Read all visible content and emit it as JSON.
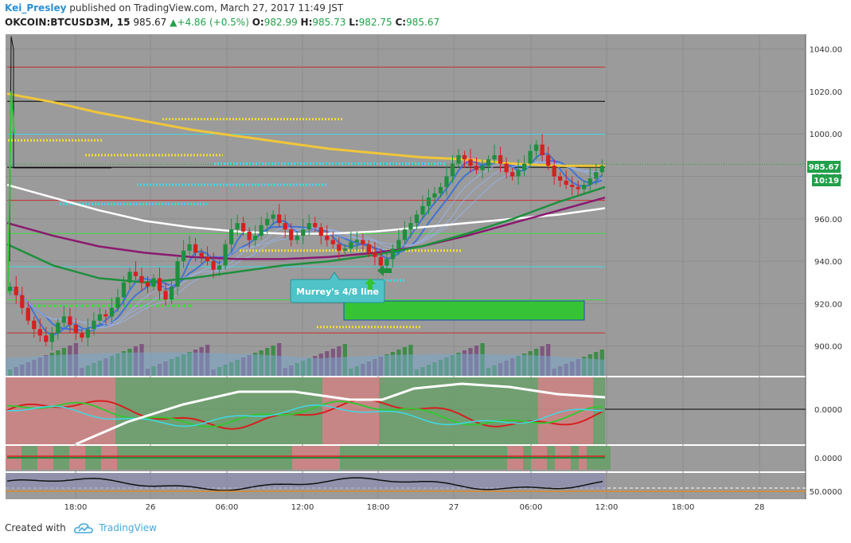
{
  "header": {
    "author": "Kei_Presley",
    "published_text": "published on TradingView.com, March 27, 2017 11:49 JST",
    "symbol": "OKCOIN:BTCUSD3M, 15",
    "last": "985.67",
    "change": "+4.86 (+0.5%)",
    "open_label": "O:",
    "open": "982.99",
    "high_label": "H:",
    "high": "985.73",
    "low_label": "L:",
    "low": "982.75",
    "close_label": "C:",
    "close": "985.67"
  },
  "annotation": {
    "text": "Murrey's 4/8 line"
  },
  "price_badge": {
    "price": "985.67",
    "countdown": "10:19"
  },
  "footer": {
    "created_with": "Created with",
    "brand": "TradingView"
  },
  "colors": {
    "background": "#9b9b9b",
    "up_candle": "#1f8f3e",
    "down_candle": "#d62020",
    "accent_green": "#22a04a",
    "cyan": "#3fd9e6",
    "yellow": "#f2dc3a",
    "tv_blue": "#2a8fd6"
  },
  "chart_data": {
    "type": "candlestick",
    "main_panel": {
      "y_ticks": [
        1040,
        1020,
        1000,
        980,
        960,
        940,
        920,
        900
      ],
      "ylim": [
        886,
        1047
      ],
      "current_price": 985.67,
      "murrey_levels": [
        {
          "price": 1031.5,
          "color": "#cc2a2a"
        },
        {
          "price": 1015.4,
          "color": "#000000"
        },
        {
          "price": 999.9,
          "color": "#3fd9e6"
        },
        {
          "price": 984.3,
          "color": "#000000"
        },
        {
          "price": 968.7,
          "color": "#cc2a2a"
        },
        {
          "price": 953.1,
          "color": "#3ddc3d"
        },
        {
          "price": 937.4,
          "color": "#3fd9e6"
        },
        {
          "price": 921.8,
          "color": "#3ddc3d"
        },
        {
          "price": 906.2,
          "color": "#cc2a2a"
        }
      ],
      "close_series": [
        928,
        924,
        918,
        912,
        908,
        905,
        902,
        906,
        911,
        914,
        910,
        906,
        904,
        908,
        912,
        915,
        914,
        918,
        923,
        930,
        935,
        933,
        930,
        928,
        932,
        926,
        922,
        928,
        940,
        945,
        948,
        944,
        942,
        940,
        936,
        938,
        948,
        955,
        958,
        954,
        950,
        952,
        957,
        960,
        962,
        958,
        955,
        950,
        952,
        955,
        958,
        956,
        952,
        950,
        948,
        945,
        946,
        949,
        950,
        948,
        944,
        942,
        938,
        941,
        946,
        950,
        955,
        958,
        962,
        966,
        970,
        972,
        975,
        980,
        986,
        990,
        988,
        985,
        983,
        985,
        988,
        990,
        986,
        982,
        980,
        983,
        986,
        992,
        995,
        990,
        985,
        980,
        978,
        976,
        975,
        974,
        976,
        979,
        982,
        985
      ],
      "moving_averages": [
        {
          "name": "ma200",
          "color": "#f0c63a",
          "values": [
            1019,
            1015,
            1010,
            1006,
            1002,
            999,
            996,
            993,
            991,
            989,
            988,
            986,
            985,
            985
          ]
        },
        {
          "name": "ma100",
          "color": "#ffffff",
          "values": [
            976,
            970,
            964,
            959,
            956,
            954,
            953,
            953,
            954,
            956,
            958,
            960,
            962,
            965
          ]
        },
        {
          "name": "ma50",
          "color": "#8a1a6e",
          "values": [
            958,
            952,
            947,
            944,
            942,
            941,
            941,
            942,
            944,
            947,
            952,
            958,
            964,
            970
          ]
        },
        {
          "name": "ma20",
          "color": "#1f8f3e",
          "values": [
            948,
            938,
            932,
            930,
            932,
            935,
            938,
            940,
            943,
            947,
            953,
            960,
            968,
            975
          ]
        }
      ],
      "dotted_levels": [
        {
          "price": 997,
          "color": "#f2dc3a"
        },
        {
          "price": 990,
          "color": "#f2dc3a"
        },
        {
          "price": 1007,
          "color": "#f2dc3a"
        },
        {
          "price": 945,
          "color": "#f2dc3a"
        },
        {
          "price": 909,
          "color": "#f2dc3a"
        },
        {
          "price": 967,
          "color": "#3fd9e6"
        },
        {
          "price": 976,
          "color": "#3fd9e6"
        },
        {
          "price": 986,
          "color": "#3fd9e6"
        },
        {
          "price": 931,
          "color": "#3fd9e6"
        },
        {
          "price": 919,
          "color": "#3ddc3d"
        }
      ]
    },
    "osc1_panel": {
      "y_ticks": [
        "0.0000"
      ]
    },
    "osc2_panel": {
      "y_ticks": [
        "0.0000"
      ]
    },
    "osc3_panel": {
      "y_ticks": [
        "50.0000"
      ]
    },
    "x_ticks": [
      "18:00",
      "26",
      "06:00",
      "12:00",
      "18:00",
      "27",
      "06:00",
      "12:00",
      "18:00",
      "28"
    ]
  }
}
